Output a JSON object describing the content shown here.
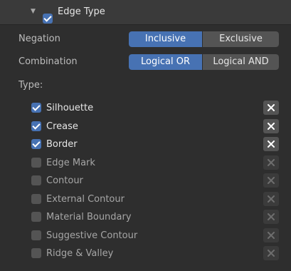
{
  "panel": {
    "title": "Edge Type",
    "enabled": true
  },
  "negation": {
    "label": "Negation",
    "options": [
      "Inclusive",
      "Exclusive"
    ],
    "selected": "Inclusive"
  },
  "combination": {
    "label": "Combination",
    "options": [
      "Logical OR",
      "Logical AND"
    ],
    "selected": "Logical OR"
  },
  "types": {
    "label": "Type:",
    "items": [
      {
        "label": "Silhouette",
        "checked": true
      },
      {
        "label": "Crease",
        "checked": true
      },
      {
        "label": "Border",
        "checked": true
      },
      {
        "label": "Edge Mark",
        "checked": false
      },
      {
        "label": "Contour",
        "checked": false
      },
      {
        "label": "External Contour",
        "checked": false
      },
      {
        "label": "Material Boundary",
        "checked": false
      },
      {
        "label": "Suggestive Contour",
        "checked": false
      },
      {
        "label": "Ridge & Valley",
        "checked": false
      }
    ]
  },
  "colors": {
    "accent": "#4772b3",
    "panel_bg": "#2e2e2e",
    "header_bg": "#3a3a3a"
  },
  "icons": {
    "collapse": "disclosure-triangle-down-icon",
    "exclude": "x-icon"
  }
}
